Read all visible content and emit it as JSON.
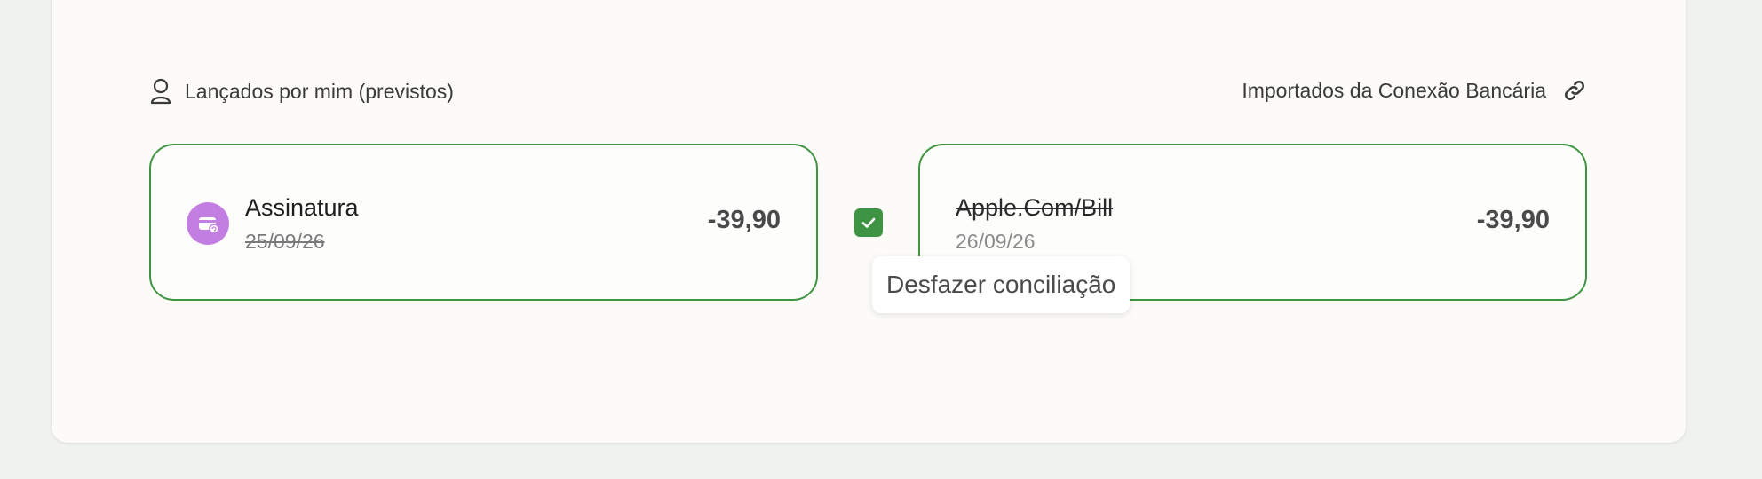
{
  "colors": {
    "page_background": "#f0f2ee",
    "panel_background": "#fcfbf7",
    "matched_border": "#3e9442",
    "checkbox": "#3e9442",
    "avatar": "#c27ee0"
  },
  "sections": {
    "left": {
      "label": "Lançados por mim (previstos)",
      "icon": "user-icon"
    },
    "right": {
      "label": "Importados da Conexão Bancária",
      "icon": "link-icon"
    }
  },
  "left_card": {
    "avatar_icon": "subscription-icon",
    "title": "Assinatura",
    "date": "25/09/26",
    "amount": "-39,90"
  },
  "right_card": {
    "title": "Apple.Com/Bill",
    "date": "26/09/26",
    "amount": "-39,90"
  },
  "reconcile": {
    "checked": true,
    "icon": "check-icon",
    "tooltip": "Desfazer conciliação"
  }
}
